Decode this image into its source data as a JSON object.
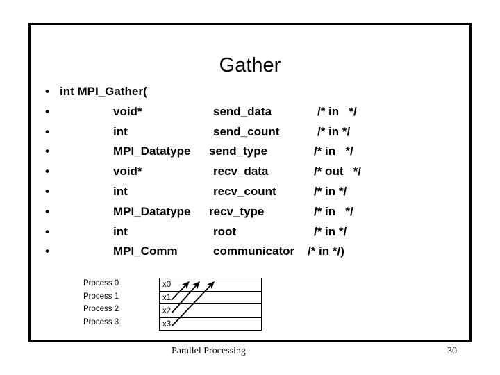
{
  "slide": {
    "title": "Gather",
    "border_color": "#000000",
    "background_color": "#ffffff",
    "text_color": "#000000"
  },
  "code": {
    "bullet_glyph": "•",
    "lines": [
      {
        "head": "int MPI_Gather(",
        "type": "",
        "name": "",
        "comment": ""
      },
      {
        "head": "",
        "type": "void*",
        "name": "send_data",
        "comment": "/* in   */"
      },
      {
        "head": "",
        "type": "int",
        "name": "send_count",
        "comment": "/* in */"
      },
      {
        "head": "",
        "type": "MPI_Datatype",
        "name": "send_type",
        "comment": "/* in   */"
      },
      {
        "head": "",
        "type": "void*",
        "name": "recv_data",
        "comment": "/* out   */"
      },
      {
        "head": "",
        "type": "int",
        "name": "recv_count",
        "comment": "/* in */"
      },
      {
        "head": "",
        "type": "MPI_Datatype",
        "name": "recv_type",
        "comment": "/* in   */"
      },
      {
        "head": "",
        "type": "int",
        "name": "root",
        "comment": "/* in */"
      },
      {
        "head": "",
        "type": "MPI_Comm",
        "name": "communicator",
        "comment": "/* in */)"
      }
    ]
  },
  "diagram": {
    "processes": [
      {
        "label": "Process 0",
        "cell": "x0"
      },
      {
        "label": "Process 1",
        "cell": "x1"
      },
      {
        "label": "Process 2",
        "cell": "x2"
      },
      {
        "label": "Process 3",
        "cell": "x3"
      }
    ]
  },
  "footer": {
    "title": "Parallel Processing",
    "page_number": "30"
  }
}
